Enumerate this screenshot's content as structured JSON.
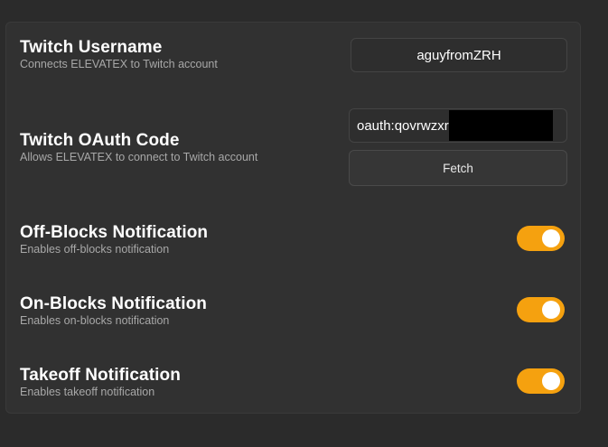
{
  "settings": {
    "username": {
      "title": "Twitch Username",
      "description": "Connects ELEVATEX to Twitch account",
      "value": "aguyfromZRH"
    },
    "oauth": {
      "title": "Twitch OAuth Code",
      "description": "Allows ELEVATEX to connect to Twitch account",
      "value": "oauth:qovrwzxr",
      "fetch_label": "Fetch"
    },
    "off_blocks": {
      "title": "Off-Blocks Notification",
      "description": "Enables off-blocks notification",
      "enabled": true
    },
    "on_blocks": {
      "title": "On-Blocks Notification",
      "description": "Enables on-blocks notification",
      "enabled": true
    },
    "takeoff": {
      "title": "Takeoff Notification",
      "description": "Enables takeoff notification",
      "enabled": true
    }
  },
  "colors": {
    "accent": "#f5a10f",
    "background": "#2b2b2b",
    "panel": "#313131"
  }
}
